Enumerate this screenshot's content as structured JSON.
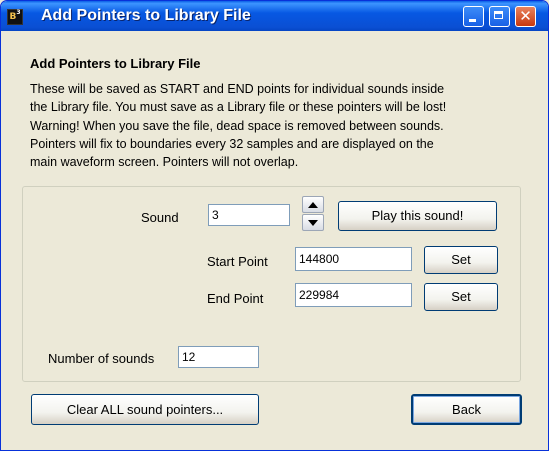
{
  "window": {
    "title": "Add Pointers to Library File",
    "app_icon_text": "B",
    "app_icon_sup": "3",
    "controls": {
      "minimize": "minimize-icon",
      "maximize": "maximize-icon",
      "close": "close-icon",
      "close_glyph": "✕"
    }
  },
  "heading": "Add Pointers to Library File",
  "description_lines": [
    "These will be saved as START and END points for individual sounds inside",
    "the Library file. You must save as a Library file or these pointers will be lost!",
    "Warning! When you save the file, dead space is removed between sounds.",
    "Pointers will fix to boundaries every 32 samples and are displayed on the",
    "main waveform screen. Pointers will not overlap."
  ],
  "sound": {
    "label": "Sound",
    "value": "3",
    "play_button": "Play this sound!"
  },
  "start_point": {
    "label": "Start Point",
    "value": "144800",
    "set_button": "Set"
  },
  "end_point": {
    "label": "End Point",
    "value": "229984",
    "set_button": "Set"
  },
  "number_of_sounds": {
    "label": "Number of sounds",
    "value": "12"
  },
  "buttons": {
    "clear": "Clear ALL sound pointers...",
    "back": "Back"
  }
}
